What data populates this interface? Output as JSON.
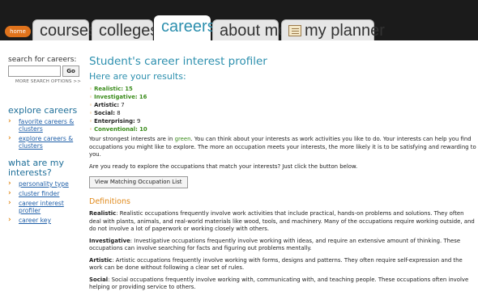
{
  "nav": {
    "home": "home",
    "tabs": [
      {
        "label": "courses"
      },
      {
        "label": "colleges"
      },
      {
        "label": "careers"
      },
      {
        "label": "about me"
      },
      {
        "label": "my planner"
      }
    ]
  },
  "sidebar": {
    "search_label": "search for careers:",
    "search_value": "",
    "go": "Go",
    "more": "MORE SEARCH OPTIONS >>",
    "explore_h": "explore careers",
    "explore_items": [
      "favorite careers & clusters",
      "explore careers & clusters"
    ],
    "interests_h": "what are my interests?",
    "interest_items": [
      "personality type",
      "cluster finder",
      "career interest profiler",
      "career key"
    ]
  },
  "main": {
    "title": "Student's career interest profiler",
    "results_h": "Here are your results:",
    "scores": [
      {
        "name": "Realistic:",
        "value": "15"
      },
      {
        "name": "Investigative:",
        "value": "16"
      },
      {
        "name": "Artistic:",
        "value": "7"
      },
      {
        "name": "Social:",
        "value": "8"
      },
      {
        "name": "Enterprising:",
        "value": "9"
      },
      {
        "name": "Conventional:",
        "value": "10"
      }
    ],
    "p1_a": "Your strongest interests are in ",
    "p1_green": "green",
    "p1_b": ". You can think about your interests as work activities you like to do. Your interests can help you find occupations you might like to explore. The more an occupation meets your interests, the more likely it is to be satisfying and rewarding to you.",
    "p2": "Are you ready to explore the occupations that match your interests? Just click the button below.",
    "button": "View Matching Occupation List",
    "defs_h": "Definitions",
    "defs": [
      {
        "term": "Realistic",
        "text": ": Realistic occupations frequently involve work activities that include practical, hands-on problems and solutions. They often deal with plants, animals, and real-world materials like wood, tools, and machinery. Many of the occupations require working outside, and do not involve a lot of paperwork or working closely with others."
      },
      {
        "term": "Investigative",
        "text": ": Investigative occupations frequently involve working with ideas, and require an extensive amount of thinking. These occupations can involve searching for facts and figuring out problems mentally."
      },
      {
        "term": "Artistic",
        "text": ": Artistic occupations frequently involve working with forms, designs and patterns. They often require self-expression and the work can be done without following a clear set of rules."
      },
      {
        "term": "Social",
        "text": ": Social occupations frequently involve working with, communicating with, and teaching people. These occupations often involve helping or providing service to others."
      }
    ]
  },
  "colors": {
    "accent": "#2c8fae",
    "orange": "#e08a1c",
    "green": "#3b8c1c",
    "link": "#1f5fa8"
  }
}
